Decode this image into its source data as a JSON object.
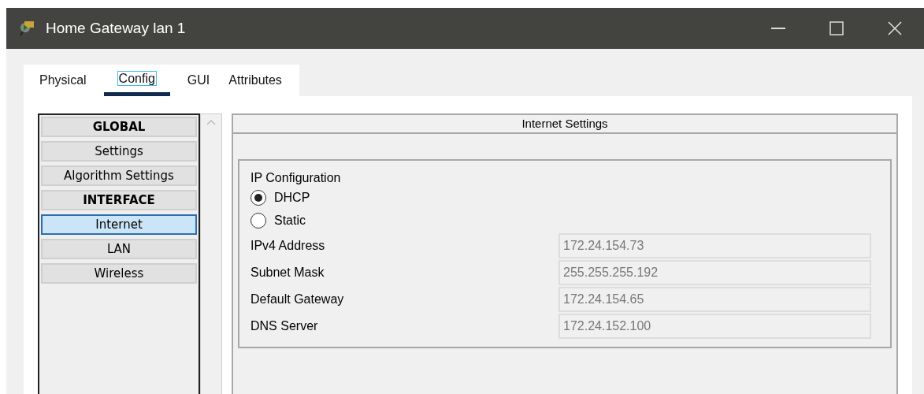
{
  "window": {
    "title": "Home Gateway lan 1"
  },
  "tabs": [
    {
      "label": "Physical",
      "selected": false
    },
    {
      "label": "Config",
      "selected": true
    },
    {
      "label": "GUI",
      "selected": false
    },
    {
      "label": "Attributes",
      "selected": false
    }
  ],
  "sidebar": {
    "items": [
      {
        "label": "GLOBAL",
        "kind": "header",
        "selected": false
      },
      {
        "label": "Settings",
        "kind": "item",
        "selected": false
      },
      {
        "label": "Algorithm Settings",
        "kind": "item",
        "selected": false
      },
      {
        "label": "INTERFACE",
        "kind": "header",
        "selected": false
      },
      {
        "label": "Internet",
        "kind": "item",
        "selected": true
      },
      {
        "label": "LAN",
        "kind": "item",
        "selected": false
      },
      {
        "label": "Wireless",
        "kind": "item",
        "selected": false
      }
    ]
  },
  "panel": {
    "title": "Internet Settings",
    "ip_configuration": {
      "title": "IP Configuration",
      "options": [
        {
          "label": "DHCP",
          "selected": true
        },
        {
          "label": "Static",
          "selected": false
        }
      ],
      "fields": [
        {
          "label": "IPv4 Address",
          "value": "172.24.154.73"
        },
        {
          "label": "Subnet Mask",
          "value": "255.255.255.192"
        },
        {
          "label": "Default Gateway",
          "value": "172.24.154.65"
        },
        {
          "label": "DNS Server",
          "value": "172.24.152.100"
        }
      ]
    }
  }
}
